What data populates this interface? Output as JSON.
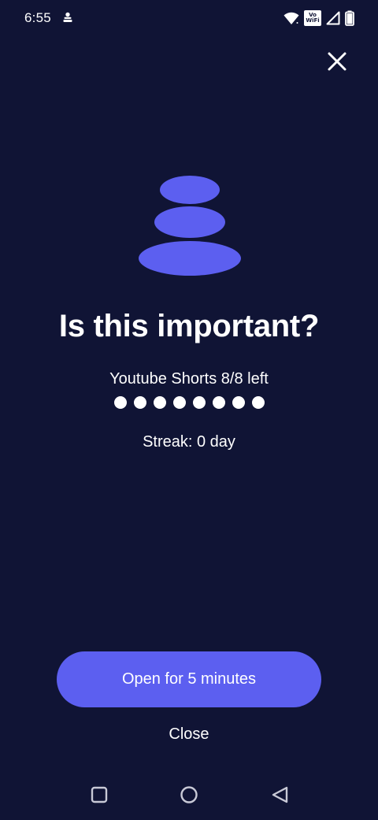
{
  "status_bar": {
    "time": "6:55",
    "vowifi_top": "Vo",
    "vowifi_bottom": "WiFi"
  },
  "colors": {
    "background": "#101435",
    "accent": "#5c5ff0",
    "text": "#ffffff"
  },
  "icons": {
    "close_top": "close-icon",
    "logo": "stacked-stones-icon",
    "nav_recents": "square-icon",
    "nav_home": "circle-icon",
    "nav_back": "triangle-back-icon"
  },
  "main": {
    "title": "Is this important?",
    "usage_text": "Youtube Shorts 8/8 left",
    "remaining_count": 8,
    "streak_text": "Streak: 0 day"
  },
  "actions": {
    "open_label": "Open for 5 minutes",
    "close_label": "Close"
  }
}
